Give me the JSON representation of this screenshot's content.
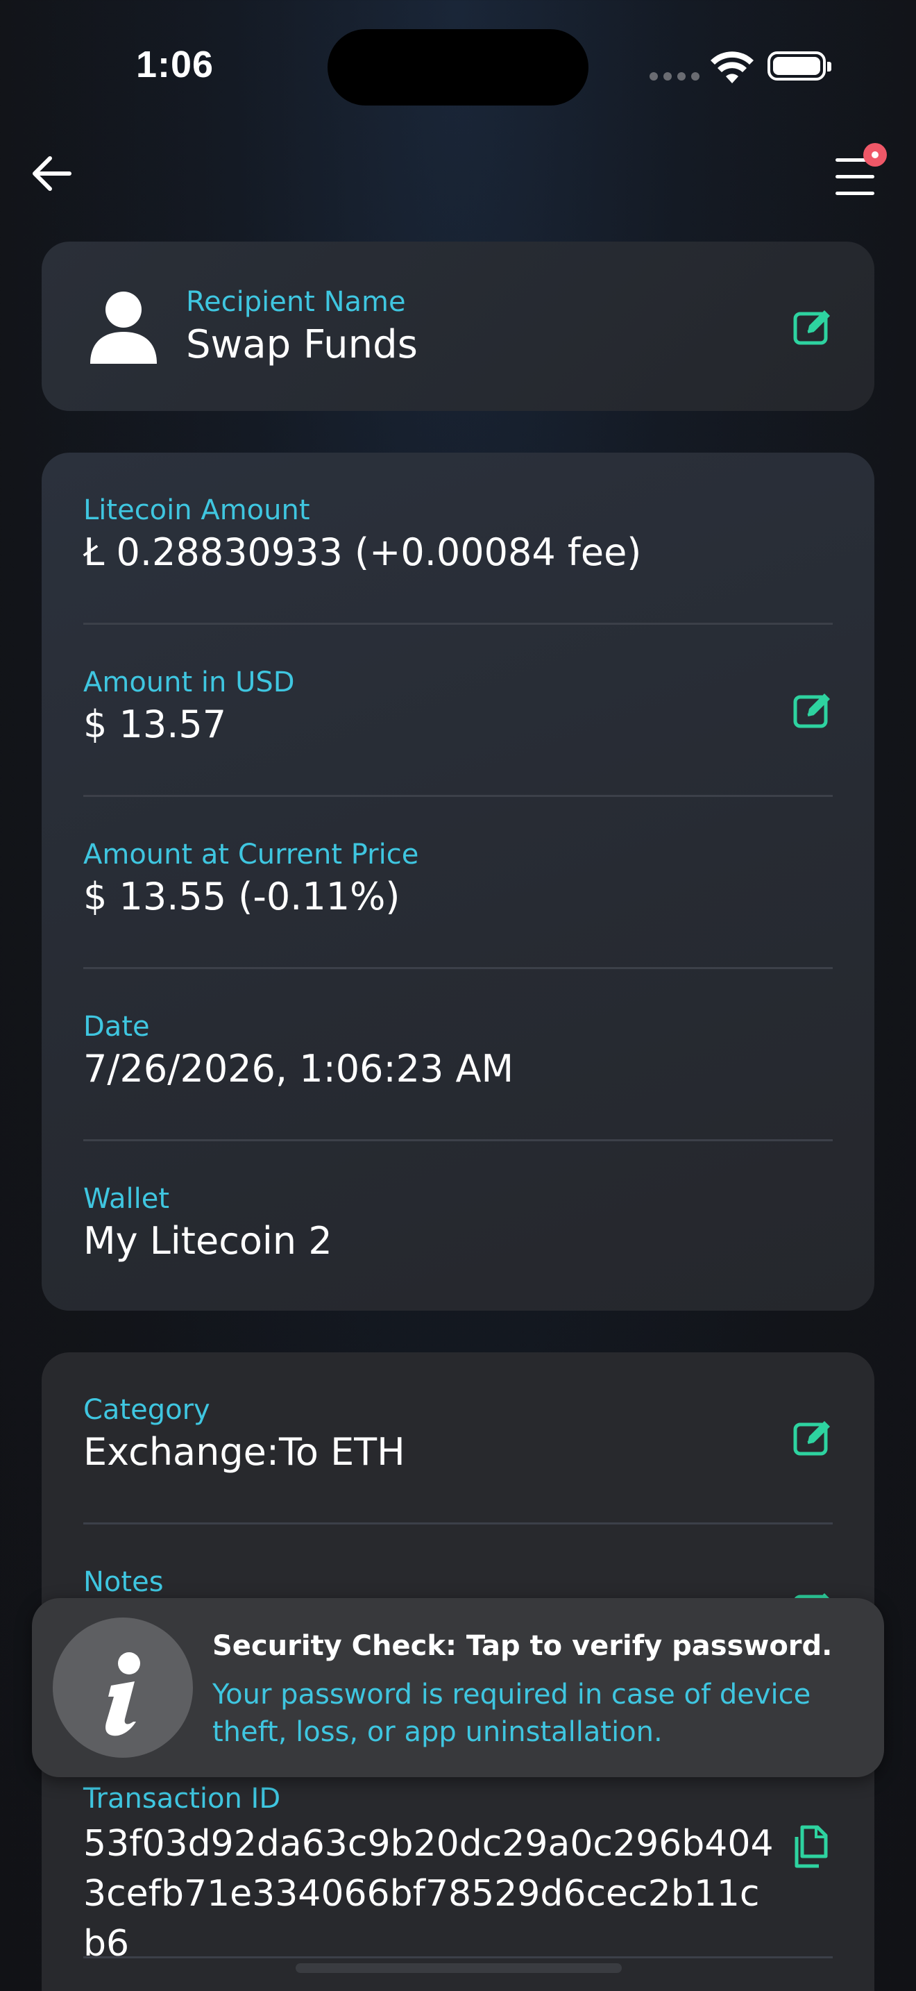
{
  "status": {
    "time": "1:06"
  },
  "recipient": {
    "label": "Recipient Name",
    "value": "Swap Funds"
  },
  "amounts": [
    {
      "label": "Litecoin Amount",
      "value": "Ł 0.28830933 (+0.00084 fee)",
      "editable": false
    },
    {
      "label": "Amount in USD",
      "value": "$ 13.57",
      "editable": true
    },
    {
      "label": "Amount at Current Price",
      "value": "$ 13.55 (-0.11%)",
      "editable": false
    },
    {
      "label": "Date",
      "value": "7/26/2026, 1:06:23 AM",
      "editable": false
    },
    {
      "label": "Wallet",
      "value": "My Litecoin 2",
      "editable": false
    }
  ],
  "details": {
    "category": {
      "label": "Category",
      "value": "Exchange:To ETH"
    },
    "notes": {
      "label": "Notes"
    },
    "transaction": {
      "label": "Transaction ID",
      "value": "53f03d92da63c9b20dc29a0c296b4043cefb71e334066bf78529d6cec2b11cb6"
    }
  },
  "toast": {
    "title": "Security Check: Tap to verify password.",
    "body": "Your password is required in case of device theft, loss, or app uninstallation."
  },
  "colors": {
    "accent_label": "#3fc6e0",
    "edit_icon": "#2ed3a0",
    "notification_dot": "#ef5868"
  },
  "icons": {
    "back": "arrow-left-icon",
    "menu": "hamburger-menu-icon",
    "person": "person-icon",
    "edit": "edit-icon",
    "copy": "copy-icon",
    "info": "info-icon"
  }
}
